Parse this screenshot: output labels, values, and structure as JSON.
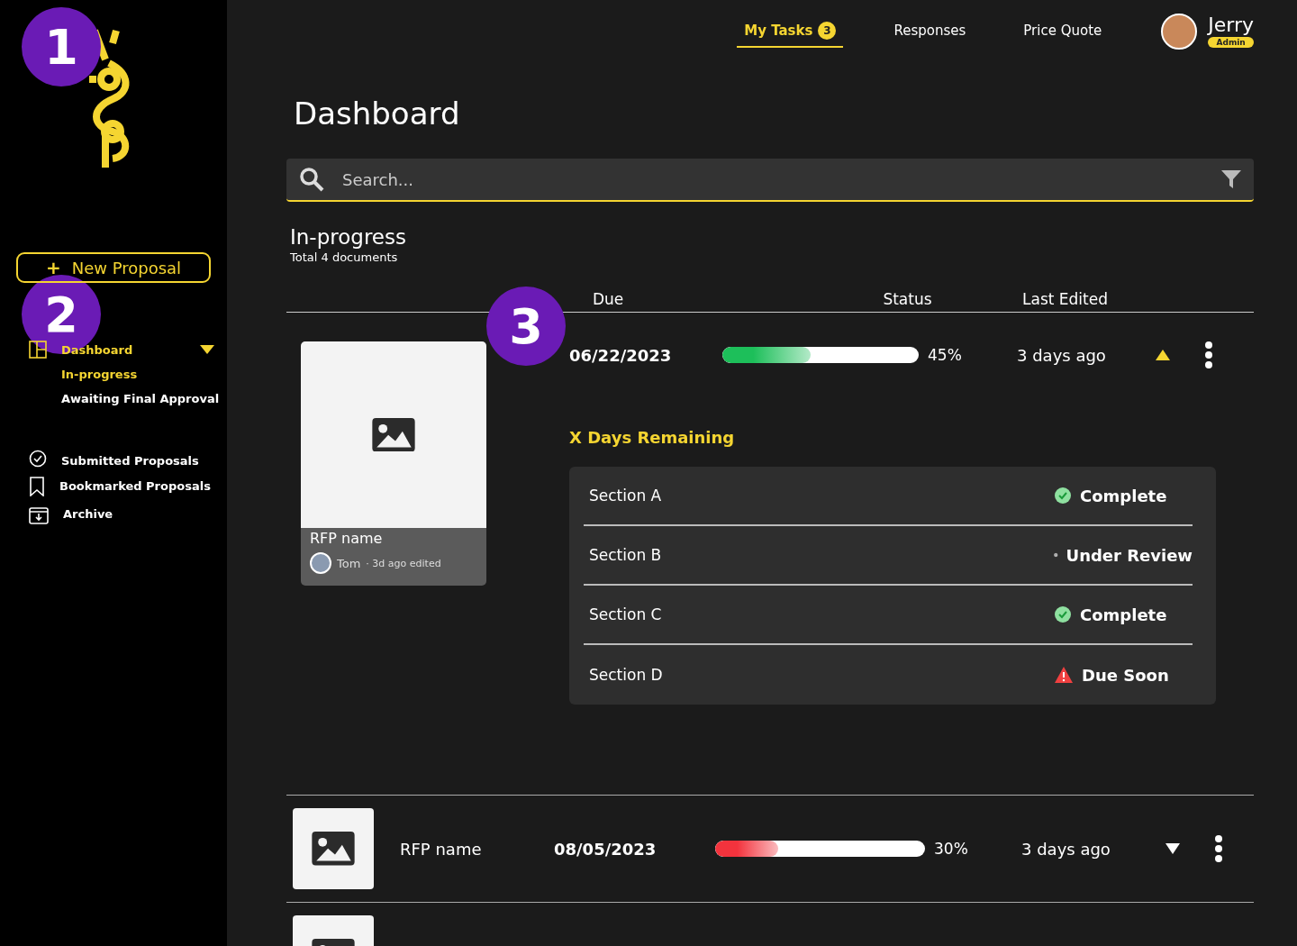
{
  "sidebar": {
    "new_button": {
      "icon_text": "+",
      "label": "New Proposal"
    },
    "items": [
      {
        "label": "Dashboard",
        "selected": true,
        "expanded": true,
        "children": [
          {
            "label": "In-progress",
            "selected": true
          },
          {
            "label": "Awaiting Final Approval",
            "selected": false
          }
        ]
      },
      {
        "label": "Submitted Proposals",
        "selected": false
      },
      {
        "label": "Bookmarked Proposals",
        "selected": false
      },
      {
        "label": "Archive",
        "selected": false
      }
    ]
  },
  "nav": {
    "tabs": [
      {
        "label": "My Tasks",
        "badge": "3",
        "selected": true
      },
      {
        "label": "Responses",
        "selected": false
      },
      {
        "label": "Price Quote",
        "selected": false
      }
    ],
    "user": {
      "name": "Jerry",
      "role": "Admin"
    }
  },
  "page_title": "Dashboard",
  "search": {
    "placeholder": "Search..."
  },
  "section": {
    "title": "In-progress",
    "subtitle": "Total 4 documents"
  },
  "table": {
    "columns": [
      "Due",
      "Status",
      "Last Edited"
    ],
    "rows": [
      {
        "name": "RFP name",
        "author": "Tom",
        "edited": "· 3d ago edited",
        "due": "06/22/2023",
        "level": 0.45,
        "percent": "45%",
        "color": "#1dbf5a",
        "last_edited": "3 days ago",
        "expanded": true,
        "remaining": "X Days Remaining",
        "sections": [
          {
            "name": "Section A",
            "status": "Complete",
            "kind": "complete"
          },
          {
            "name": "Section B",
            "status": "Under Review",
            "kind": "review"
          },
          {
            "name": "Section C",
            "status": "Complete",
            "kind": "complete"
          },
          {
            "name": "Section D",
            "status": "Due Soon",
            "kind": "due_soon"
          }
        ]
      },
      {
        "name": "RFP name",
        "due": "08/05/2023",
        "level": 0.3,
        "percent": "30%",
        "color": "#f3333d",
        "last_edited": "3 days ago",
        "expanded": false
      },
      {
        "expanded": false
      }
    ]
  },
  "callouts": [
    "1",
    "2",
    "3"
  ]
}
